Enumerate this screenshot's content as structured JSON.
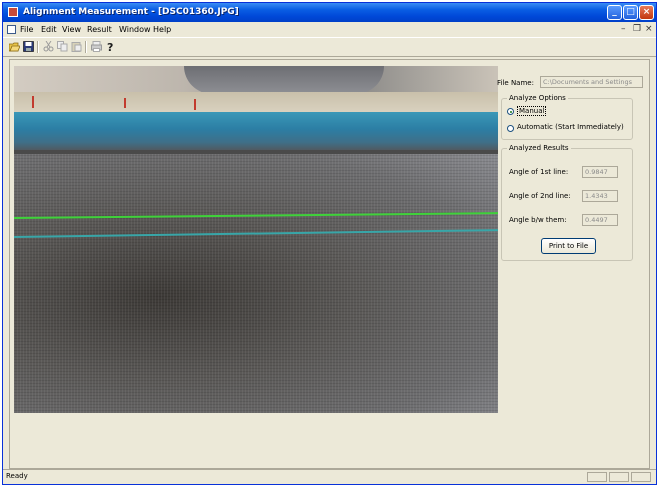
{
  "window": {
    "title": "Alignment Measurement - [DSC01360.JPG]"
  },
  "menu": [
    "File",
    "Edit",
    "View",
    "Result",
    "Window",
    "Help"
  ],
  "toolbar": {
    "icons": [
      "open-icon",
      "save-icon",
      "cut-icon",
      "copy-icon",
      "paste-icon",
      "print-icon",
      "help-icon"
    ]
  },
  "panel": {
    "file_name_label": "File Name:",
    "file_name_value": "C:\\Documents and Settings",
    "analyze_options": {
      "title": "Analyze Options",
      "manual": "Manual",
      "automatic": "Automatic (Start Immediately)",
      "selected": "Manual"
    },
    "results": {
      "title": "Analyzed Results",
      "angle1_label": "Angle of 1st line:",
      "angle1_value": "0.9847",
      "angle2_label": "Angle of 2nd line:",
      "angle2_value": "1.4343",
      "between_label": "Angle b/w them:",
      "between_value": "0.4497",
      "print_button": "Print to File"
    }
  },
  "status": {
    "text": "Ready"
  },
  "colors": {
    "titlebar": "#0054e3",
    "line_green": "#3fd23a",
    "line_teal": "#38a6a8",
    "stripe_blue": "#2f7fa7"
  }
}
